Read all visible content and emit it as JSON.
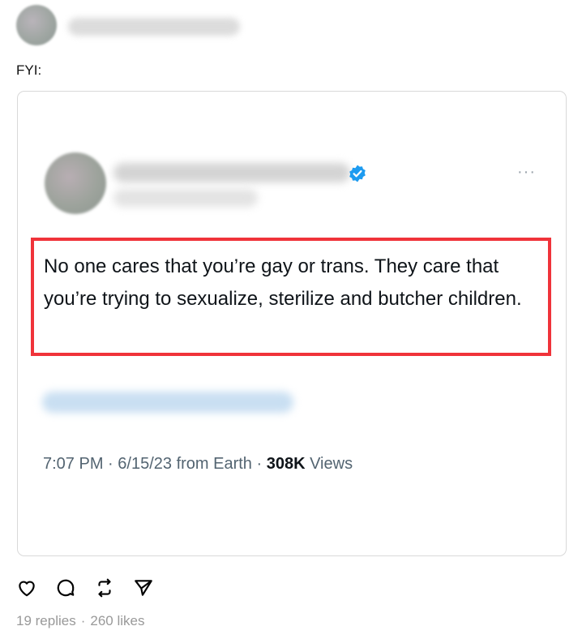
{
  "post": {
    "caption": "FYI:",
    "stats": {
      "replies": "19 replies",
      "separator": "·",
      "likes": "260 likes"
    }
  },
  "embedded_tweet": {
    "text": "No one cares that you’re gay or trans. They care that you’re trying to sexualize, sterilize and butcher children.",
    "time": "7:07 PM",
    "date": "6/15/23",
    "source": "from Earth",
    "views_count": "308K",
    "views_label": "Views",
    "more_glyph": "···"
  },
  "icons": {
    "like": "heart-icon",
    "reply": "comment-icon",
    "repost": "repost-icon",
    "share": "send-icon",
    "verified": "verified-badge-icon"
  },
  "colors": {
    "highlight_border": "#f0333a",
    "verified_blue": "#1d9bf0",
    "muted_text": "#536471"
  }
}
